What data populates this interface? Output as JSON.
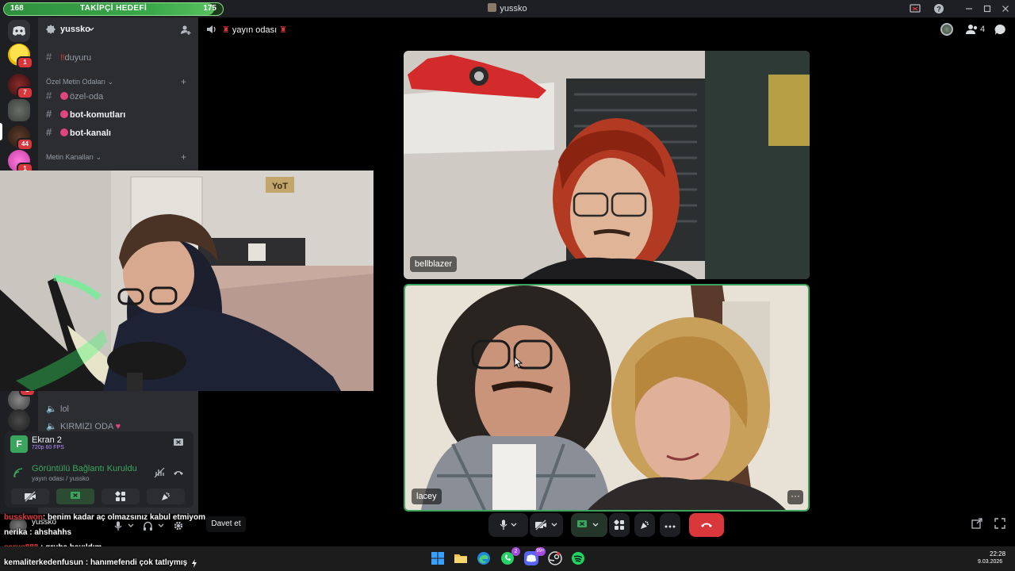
{
  "titlebar": {
    "goal_label": "TAKİPÇİ HEDEFİ",
    "goal_current": "168",
    "goal_target": "175",
    "goal_progress_fraction": 0.96,
    "window_title": "yussko"
  },
  "rail": {
    "badges": [
      "1",
      "7",
      "44",
      "1"
    ]
  },
  "sidebar": {
    "server_name": "yussko",
    "channels": [
      {
        "name": "duyuru",
        "prefix": "‼"
      },
      {
        "name": "özel-oda"
      },
      {
        "name": "bot-komutları"
      },
      {
        "name": "bot-kanalı"
      }
    ],
    "categories": [
      "Özel Metin Odaları",
      "Metin Kanalları"
    ],
    "voice_channels": [
      "lol",
      "KIRMIZI ODA"
    ]
  },
  "voice_panel": {
    "stream_title": "Ekran 2",
    "stream_quality": "720p 60 FPS",
    "connection_status": "Görüntülü Bağlantı Kuruldu",
    "connection_detail": "yayın odası / yussko",
    "user_name": "yussko",
    "invite_label": "Davet et"
  },
  "voice_header": {
    "channel_name": "yayın odası",
    "member_count": "4"
  },
  "participants": [
    {
      "name": "bellblazer"
    },
    {
      "name": "lacey"
    }
  ],
  "chat": [
    {
      "user": "busskwon",
      "message": "benim kadar aç olmazsınız kabul etmiyom",
      "color": "#e03a3a"
    },
    {
      "user": "nerika",
      "message": "ahshahhs",
      "color": "#ffffff"
    },
    {
      "user": "sarus888",
      "message": "gruba bayıldım",
      "color": "#e03a3a"
    },
    {
      "user": "kemaliterkedenfusun",
      "message": "hanımefendi çok tatlıymış",
      "color": "#ffffff"
    }
  ],
  "taskbar": {
    "time": "22:28",
    "date": "9.03.2026",
    "whatsapp_badge": "2",
    "discord_badge": "99+"
  }
}
